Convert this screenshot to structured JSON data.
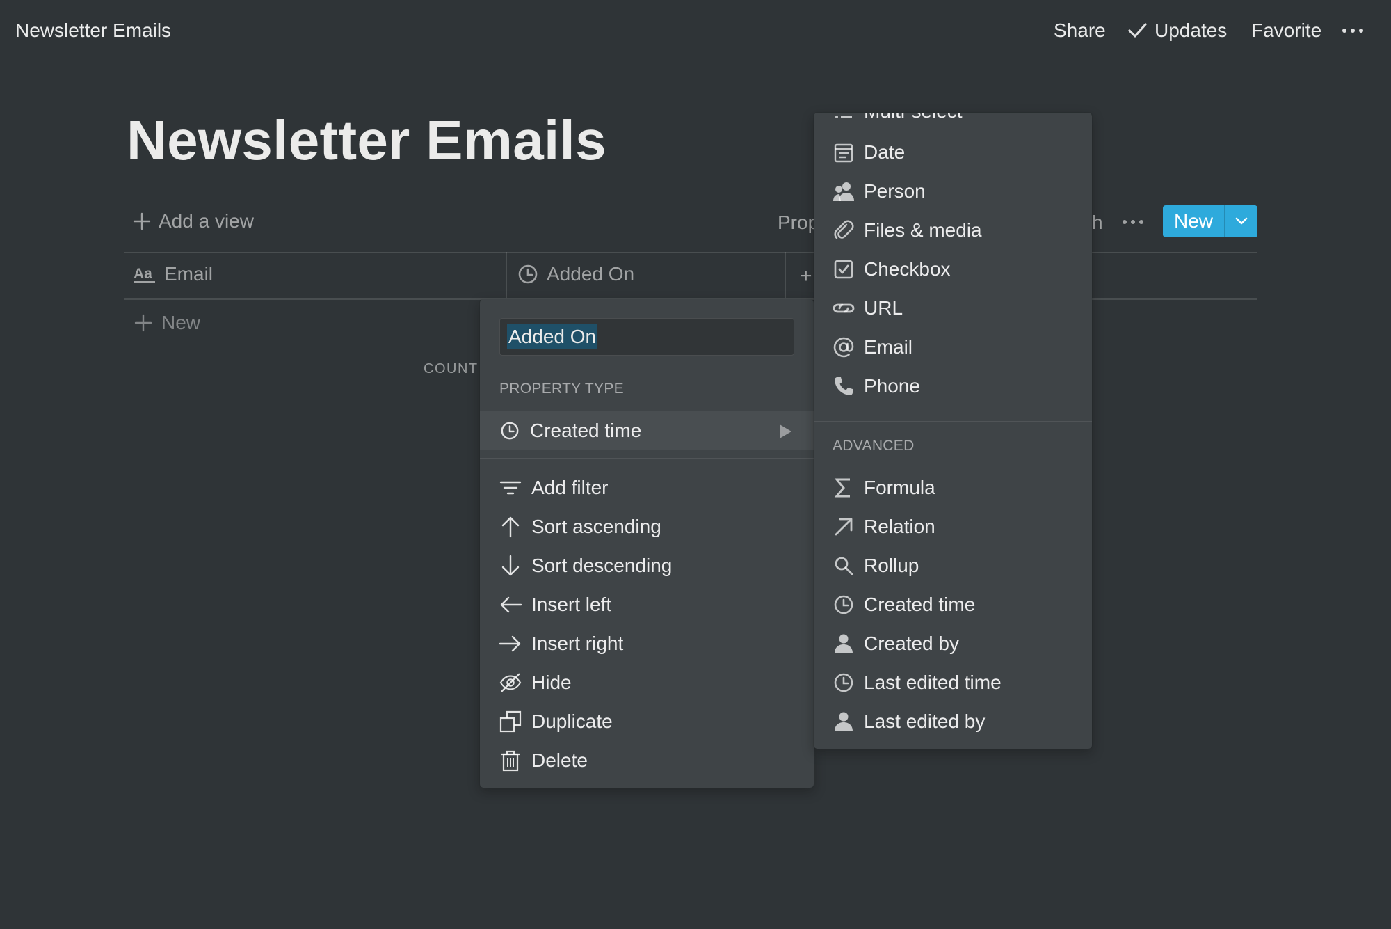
{
  "topbar": {
    "title": "Newsletter Emails",
    "share_label": "Share",
    "updates_label": "Updates",
    "favorite_label": "Favorite"
  },
  "page": {
    "title": "Newsletter Emails",
    "add_view_label": "Add a view",
    "properties_label_partial": "Prop",
    "search_label_partial": "h",
    "new_button_label": "New"
  },
  "table": {
    "columns": [
      {
        "label": "Email",
        "icon": "text-type-icon"
      },
      {
        "label": "Added On",
        "icon": "clock-icon"
      }
    ],
    "add_column_symbol": "+",
    "new_row_label": "New",
    "count_label_partial": "COUNT"
  },
  "column_menu": {
    "name_value": "Added On",
    "property_type_heading": "PROPERTY TYPE",
    "current_type": "Created time",
    "actions": [
      {
        "label": "Add filter",
        "icon": "filter-icon"
      },
      {
        "label": "Sort ascending",
        "icon": "arrow-up-icon"
      },
      {
        "label": "Sort descending",
        "icon": "arrow-down-icon"
      },
      {
        "label": "Insert left",
        "icon": "arrow-left-icon"
      },
      {
        "label": "Insert right",
        "icon": "arrow-right-icon"
      },
      {
        "label": "Hide",
        "icon": "eye-off-icon"
      },
      {
        "label": "Duplicate",
        "icon": "duplicate-icon"
      },
      {
        "label": "Delete",
        "icon": "trash-icon"
      }
    ]
  },
  "type_menu": {
    "basic": [
      {
        "label": "Multi-select",
        "icon": "list-icon"
      },
      {
        "label": "Date",
        "icon": "calendar-icon"
      },
      {
        "label": "Person",
        "icon": "people-icon"
      },
      {
        "label": "Files & media",
        "icon": "paperclip-icon"
      },
      {
        "label": "Checkbox",
        "icon": "checkbox-icon"
      },
      {
        "label": "URL",
        "icon": "link-icon"
      },
      {
        "label": "Email",
        "icon": "at-icon"
      },
      {
        "label": "Phone",
        "icon": "phone-icon"
      }
    ],
    "advanced_heading": "ADVANCED",
    "advanced": [
      {
        "label": "Formula",
        "icon": "sigma-icon"
      },
      {
        "label": "Relation",
        "icon": "arrow-up-right-icon"
      },
      {
        "label": "Rollup",
        "icon": "search-icon"
      },
      {
        "label": "Created time",
        "icon": "clock-icon"
      },
      {
        "label": "Created by",
        "icon": "person-icon"
      },
      {
        "label": "Last edited time",
        "icon": "clock-icon"
      },
      {
        "label": "Last edited by",
        "icon": "person-icon"
      }
    ]
  },
  "colors": {
    "background": "#2f3437",
    "menu": "#3f4447",
    "accent": "#2eaadc",
    "selection": "#1f5068"
  }
}
